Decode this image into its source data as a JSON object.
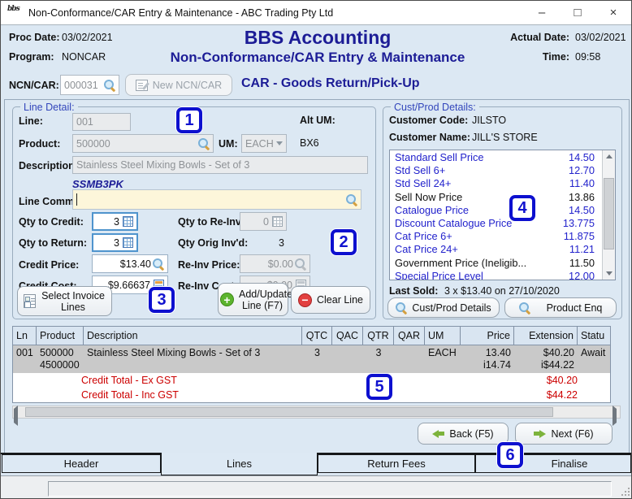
{
  "window": {
    "logo_text": "bbs",
    "title": "Non-Conformance/CAR Entry & Maintenance - ABC Trading Pty Ltd",
    "controls": {
      "minimize": "–",
      "maximize": "□",
      "close": "×"
    }
  },
  "header": {
    "proc_date_label": "Proc Date:",
    "proc_date": "03/02/2021",
    "program_label": "Program:",
    "program": "NONCAR",
    "app_title": "BBS Accounting",
    "screen_title": "Non-Conformance/CAR Entry & Maintenance",
    "actual_date_label": "Actual Date:",
    "actual_date": "03/02/2021",
    "time_label": "Time:",
    "time": "09:58"
  },
  "ncn": {
    "label": "NCN/CAR:",
    "value": "000031",
    "new_button": "New NCN/CAR",
    "mode_title": "CAR - Goods Return/Pick-Up"
  },
  "line_detail": {
    "legend": "Line Detail:",
    "line_label": "Line:",
    "line_value": "001",
    "alt_um_label": "Alt UM:",
    "alt_um_value": "BX6",
    "product_label": "Product:",
    "product_value": "500000",
    "um_label": "UM:",
    "um_value": "EACH",
    "description_label": "Description:",
    "description_value": "Stainless Steel Mixing Bowls - Set of 3",
    "product_code": "SSMB3PK",
    "line_comm_label": "Line Comm:",
    "line_comm_value": "",
    "qty_credit_label": "Qty to Credit:",
    "qty_credit": "3",
    "qty_reinv_label": "Qty to Re-Inv:",
    "qty_reinv": "0",
    "qty_return_label": "Qty to Return:",
    "qty_return": "3",
    "qty_orig_label": "Qty Orig Inv'd:",
    "qty_orig": "3",
    "credit_price_label": "Credit Price:",
    "credit_price": "$13.40",
    "reinv_price_label": "Re-Inv Price:",
    "reinv_price": "$0.00",
    "credit_cost_label": "Credit Cost:",
    "credit_cost": "$9.66637",
    "reinv_cost_label": "Re-Inv Cost:",
    "reinv_cost": "$0.00",
    "select_invoice_btn": "Select Invoice Lines",
    "add_update_btn": "Add/Update Line (F7)",
    "clear_btn": "Clear Line"
  },
  "cust_prod": {
    "legend": "Cust/Prod Details:",
    "code_label": "Customer Code:",
    "code": "JILSTO",
    "name_label": "Customer Name:",
    "name": "JILL'S STORE",
    "prices": [
      {
        "name": "Standard Sell Price",
        "value": "14.50"
      },
      {
        "name": "Std Sell 6+",
        "value": "12.70"
      },
      {
        "name": "Std Sell 24+",
        "value": "11.40"
      },
      {
        "name": "Sell Now Price",
        "value": "13.86"
      },
      {
        "name": "Catalogue Price",
        "value": "14.50"
      },
      {
        "name": "Discount Catalogue Price",
        "value": "13.775"
      },
      {
        "name": "Cat Price 6+",
        "value": "11.875"
      },
      {
        "name": "Cat Price 24+",
        "value": "11.21"
      },
      {
        "name": "Government Price (Ineligib...",
        "value": "11.50"
      },
      {
        "name": "Special Price Level",
        "value": "12.00"
      }
    ],
    "last_sold_label": "Last Sold:",
    "last_sold": "3 x $13.40 on 27/10/2020",
    "details_btn": "Cust/Prod Details",
    "enq_btn": "Product Enq"
  },
  "lines_table": {
    "columns": [
      "Ln",
      "Product",
      "Description",
      "QTC",
      "QAC",
      "QTR",
      "QAR",
      "UM",
      "Price",
      "Extension",
      "Statu"
    ],
    "row": {
      "ln": "001",
      "product": "500000",
      "product_alt": "4500000",
      "description": "Stainless Steel Mixing Bowls - Set of 3",
      "qtc": "3",
      "qac": "",
      "qtr": "3",
      "qar": "",
      "um": "EACH",
      "price": "13.40",
      "price_inc": "i14.74",
      "extension": "$40.20",
      "extension_inc": "i$44.22",
      "status": "Await"
    },
    "totals": [
      {
        "label": "Credit Total - Ex GST",
        "value": "$40.20"
      },
      {
        "label": "Credit Total - Inc GST",
        "value": "$44.22"
      }
    ]
  },
  "nav": {
    "back": "Back (F5)",
    "next": "Next (F6)"
  },
  "tabs": [
    {
      "label": "Header"
    },
    {
      "label": "Lines"
    },
    {
      "label": "Return Fees"
    },
    {
      "label": "Finalise"
    }
  ],
  "annotations": {
    "1": "1",
    "2": "2",
    "3": "3",
    "4": "4",
    "5": "5",
    "6": "6"
  },
  "colors": {
    "navy": "#1c1c96",
    "red": "#cc0000",
    "price_blue": "#2222cc",
    "annotation_blue": "#0d10cf",
    "selected_row_gray": "#c9c9c9",
    "window_bg": "#dce8f3"
  }
}
